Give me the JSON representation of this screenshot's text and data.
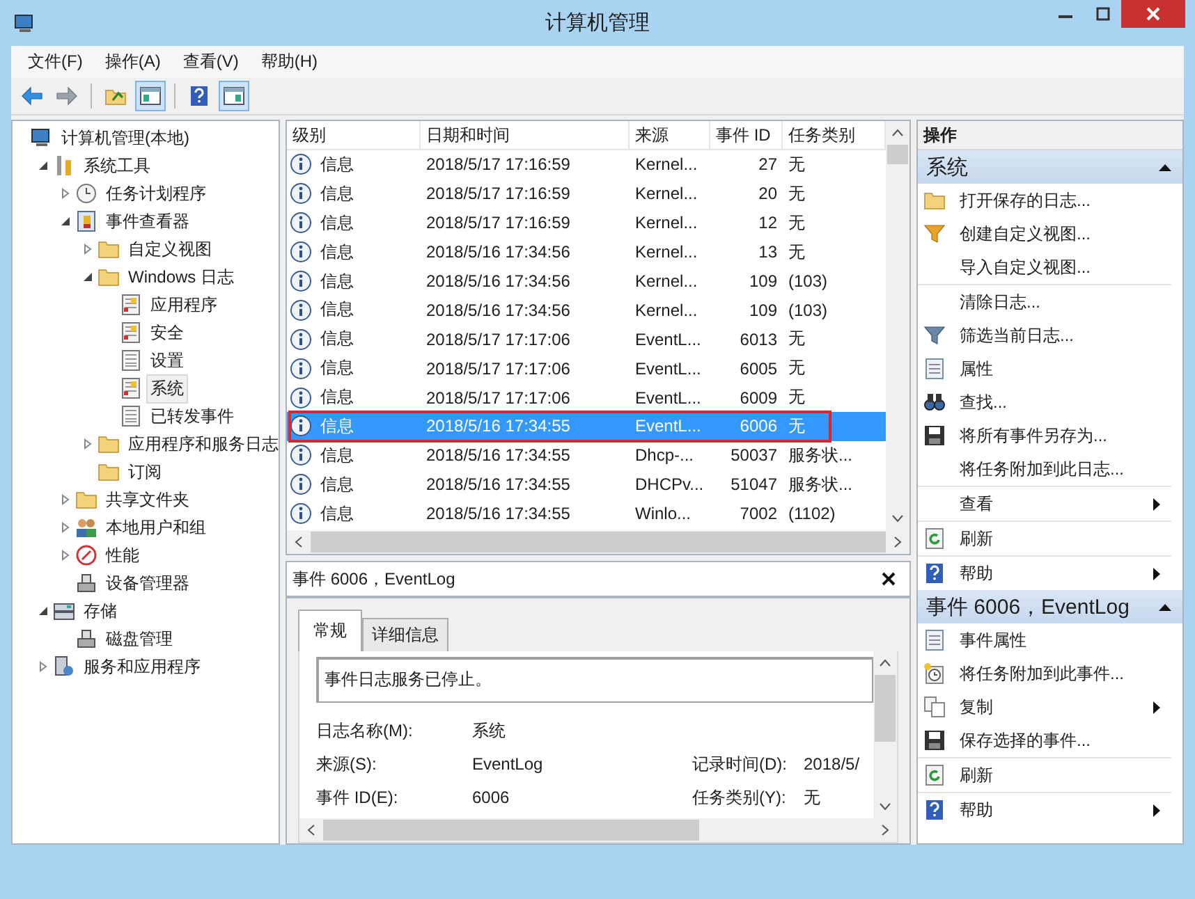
{
  "window": {
    "title": "计算机管理"
  },
  "menu": [
    "文件(F)",
    "操作(A)",
    "查看(V)",
    "帮助(H)"
  ],
  "toolbar": [
    {
      "kind": "back",
      "on": false
    },
    {
      "kind": "forward",
      "on": false
    },
    {
      "kind": "separator"
    },
    {
      "kind": "up",
      "on": false
    },
    {
      "kind": "tree",
      "on": true
    },
    {
      "kind": "separator"
    },
    {
      "kind": "help",
      "on": false
    },
    {
      "kind": "pane",
      "on": true
    }
  ],
  "tree": [
    {
      "label": "计算机管理(本地)",
      "kind": "computer",
      "selected": false,
      "children": [
        {
          "label": "系统工具",
          "kind": "tools",
          "expanded": true,
          "selected": false,
          "children": [
            {
              "label": "任务计划程序",
              "kind": "clock",
              "expanded": false,
              "selected": false
            },
            {
              "label": "事件查看器",
              "kind": "viewer",
              "expanded": true,
              "selected": false,
              "children": [
                {
                  "label": "自定义视图",
                  "kind": "folder",
                  "expanded": false,
                  "selected": false
                },
                {
                  "label": "Windows 日志",
                  "kind": "folder",
                  "expanded": true,
                  "selected": false,
                  "children": [
                    {
                      "label": "应用程序",
                      "kind": "log",
                      "selected": false
                    },
                    {
                      "label": "安全",
                      "kind": "log",
                      "selected": false
                    },
                    {
                      "label": "设置",
                      "kind": "page",
                      "selected": false
                    },
                    {
                      "label": "系统",
                      "kind": "log",
                      "selected": true
                    },
                    {
                      "label": "已转发事件",
                      "kind": "page",
                      "selected": false
                    }
                  ]
                },
                {
                  "label": "应用程序和服务日志",
                  "kind": "folder",
                  "expanded": false,
                  "selected": false
                },
                {
                  "label": "订阅",
                  "kind": "folder",
                  "selected": false
                }
              ]
            },
            {
              "label": "共享文件夹",
              "kind": "folder",
              "expanded": false,
              "selected": false
            },
            {
              "label": "本地用户和组",
              "kind": "users",
              "expanded": false,
              "selected": false
            },
            {
              "label": "性能",
              "kind": "gauge",
              "expanded": false,
              "selected": false
            },
            {
              "label": "设备管理器",
              "kind": "device",
              "selected": false
            }
          ]
        },
        {
          "label": "存储",
          "kind": "storage",
          "expanded": true,
          "selected": false,
          "children": [
            {
              "label": "磁盘管理",
              "kind": "device",
              "selected": false
            }
          ]
        },
        {
          "label": "服务和应用程序",
          "kind": "services",
          "expanded": false,
          "selected": false
        }
      ]
    }
  ],
  "table": {
    "columns": [
      "级别",
      "日期和时间",
      "来源",
      "事件 ID",
      "任务类别"
    ],
    "rows": [
      {
        "level": "信息",
        "date": "2018/5/17 17:16:59",
        "source": "Kernel...",
        "event_id": "27",
        "task": "无",
        "selected": false,
        "outlined": false
      },
      {
        "level": "信息",
        "date": "2018/5/17 17:16:59",
        "source": "Kernel...",
        "event_id": "20",
        "task": "无",
        "selected": false,
        "outlined": false
      },
      {
        "level": "信息",
        "date": "2018/5/17 17:16:59",
        "source": "Kernel...",
        "event_id": "12",
        "task": "无",
        "selected": false,
        "outlined": false
      },
      {
        "level": "信息",
        "date": "2018/5/16 17:34:56",
        "source": "Kernel...",
        "event_id": "13",
        "task": "无",
        "selected": false,
        "outlined": false
      },
      {
        "level": "信息",
        "date": "2018/5/16 17:34:56",
        "source": "Kernel...",
        "event_id": "109",
        "task": "(103)",
        "selected": false,
        "outlined": false
      },
      {
        "level": "信息",
        "date": "2018/5/16 17:34:56",
        "source": "Kernel...",
        "event_id": "109",
        "task": "(103)",
        "selected": false,
        "outlined": false
      },
      {
        "level": "信息",
        "date": "2018/5/17 17:17:06",
        "source": "EventL...",
        "event_id": "6013",
        "task": "无",
        "selected": false,
        "outlined": false
      },
      {
        "level": "信息",
        "date": "2018/5/17 17:17:06",
        "source": "EventL...",
        "event_id": "6005",
        "task": "无",
        "selected": false,
        "outlined": false
      },
      {
        "level": "信息",
        "date": "2018/5/17 17:17:06",
        "source": "EventL...",
        "event_id": "6009",
        "task": "无",
        "selected": false,
        "outlined": false
      },
      {
        "level": "信息",
        "date": "2018/5/16 17:34:55",
        "source": "EventL...",
        "event_id": "6006",
        "task": "无",
        "selected": true,
        "outlined": true
      },
      {
        "level": "信息",
        "date": "2018/5/16 17:34:55",
        "source": "Dhcp-...",
        "event_id": "50037",
        "task": "服务状...",
        "selected": false,
        "outlined": false
      },
      {
        "level": "信息",
        "date": "2018/5/16 17:34:55",
        "source": "DHCPv...",
        "event_id": "51047",
        "task": "服务状...",
        "selected": false,
        "outlined": false
      },
      {
        "level": "信息",
        "date": "2018/5/16 17:34:55",
        "source": "Winlo...",
        "event_id": "7002",
        "task": "(1102)",
        "selected": false,
        "outlined": false
      }
    ]
  },
  "detail": {
    "title": "事件 6006，EventLog",
    "tabs": [
      {
        "label": "常规",
        "selected": true
      },
      {
        "label": "详细信息",
        "selected": false
      }
    ],
    "message": "事件日志服务已停止。",
    "rows": [
      [
        {
          "label": "日志名称(M):",
          "value": "系统"
        }
      ],
      [
        {
          "label": "来源(S):",
          "value": "EventLog"
        },
        {
          "label": "记录时间(D):",
          "value": "2018/5/"
        }
      ],
      [
        {
          "label": "事件 ID(E):",
          "value": "6006"
        },
        {
          "label": "任务类别(Y):",
          "value": "无"
        }
      ]
    ]
  },
  "actions": {
    "title": "操作",
    "sections": [
      {
        "title": "系统",
        "expanded": true,
        "items": [
          {
            "label": "打开保存的日志...",
            "kind": "folder",
            "submenu": false,
            "divider": false
          },
          {
            "label": "创建自定义视图...",
            "kind": "funnel",
            "submenu": false,
            "divider": false
          },
          {
            "label": "导入自定义视图...",
            "kind": "plain",
            "submenu": false,
            "divider": true
          },
          {
            "label": "清除日志...",
            "kind": "plain",
            "submenu": false,
            "divider": false
          },
          {
            "label": "筛选当前日志...",
            "kind": "filter",
            "submenu": false,
            "divider": false
          },
          {
            "label": "属性",
            "kind": "properties",
            "submenu": false,
            "divider": false
          },
          {
            "label": "查找...",
            "kind": "binoculars",
            "submenu": false,
            "divider": false
          },
          {
            "label": "将所有事件另存为...",
            "kind": "save",
            "submenu": false,
            "divider": false
          },
          {
            "label": "将任务附加到此日志...",
            "kind": "plain",
            "submenu": false,
            "divider": true
          },
          {
            "label": "查看",
            "kind": "plain",
            "submenu": true,
            "divider": true
          },
          {
            "label": "刷新",
            "kind": "refresh",
            "submenu": false,
            "divider": true
          },
          {
            "label": "帮助",
            "kind": "help",
            "submenu": true,
            "divider": false
          }
        ]
      },
      {
        "title": "事件 6006，EventLog",
        "expanded": true,
        "items": [
          {
            "label": "事件属性",
            "kind": "properties",
            "submenu": false,
            "divider": false
          },
          {
            "label": "将任务附加到此事件...",
            "kind": "task",
            "submenu": false,
            "divider": false
          },
          {
            "label": "复制",
            "kind": "copy",
            "submenu": true,
            "divider": false
          },
          {
            "label": "保存选择的事件...",
            "kind": "save",
            "submenu": false,
            "divider": true
          },
          {
            "label": "刷新",
            "kind": "refresh",
            "submenu": false,
            "divider": true
          },
          {
            "label": "帮助",
            "kind": "help",
            "submenu": true,
            "divider": false
          }
        ]
      }
    ]
  }
}
